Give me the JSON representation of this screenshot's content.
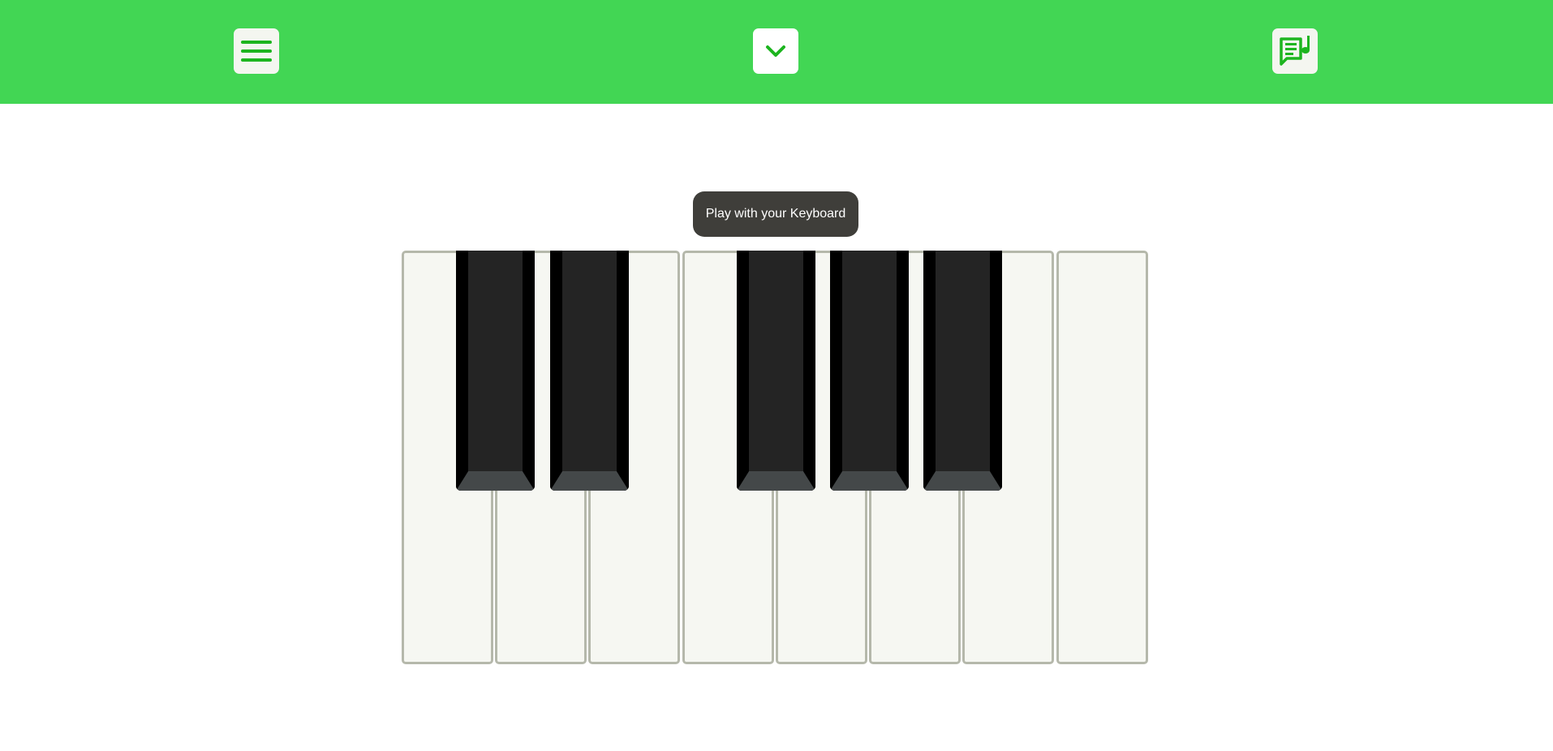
{
  "toolbar": {
    "menu_icon": "hamburger-menu-icon",
    "dropdown_icon": "chevron-down-icon",
    "songs_icon": "music-notes-chat-icon",
    "accent_color": "#42d654",
    "icon_color": "#1db51f"
  },
  "tooltip": {
    "text": "Play with your Keyboard"
  },
  "piano": {
    "white_keys": 8,
    "black_keys": 5,
    "white_key_color": "#f6f7f2",
    "black_key_color": "#242424"
  }
}
